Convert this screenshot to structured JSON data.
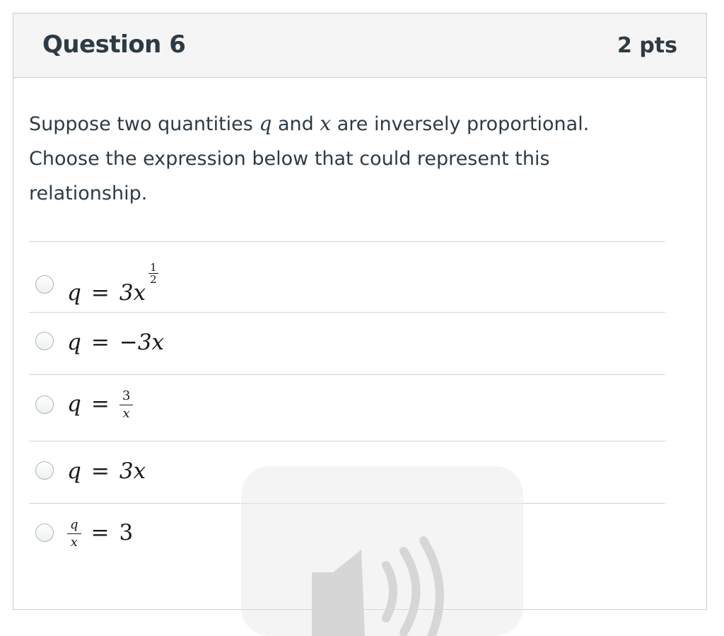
{
  "question": {
    "title": "Question 6",
    "points": "2 pts",
    "text_part1": "Suppose two quantities ",
    "var_q": "q",
    "text_part2": " and ",
    "var_x": "x",
    "text_part3": " are inversely proportional. Choose the expression below that could represent this relationship."
  },
  "answers": [
    {
      "lhs": "q",
      "eq": "=",
      "rhs": "3x",
      "exp_num": "1",
      "exp_den": "2",
      "selected": false
    },
    {
      "lhs": "q",
      "eq": "=",
      "rhs": "−3x",
      "selected": false
    },
    {
      "lhs": "q",
      "eq": "=",
      "frac_num": "3",
      "frac_den": "x",
      "selected": false
    },
    {
      "lhs": "q",
      "eq": "=",
      "rhs": "3x",
      "selected": false
    },
    {
      "frac_num": "q",
      "frac_den": "x",
      "eq": "=",
      "rhs": "3",
      "selected": false
    }
  ],
  "overlay": {
    "icon": "speaker-icon"
  }
}
